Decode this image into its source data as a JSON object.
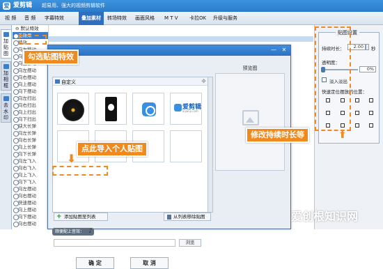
{
  "app": {
    "logo_glyph": "爱",
    "name": "爱剪辑",
    "slogan": "超易用、强大的视频剪辑软件"
  },
  "menu": {
    "items": [
      {
        "label": "视 频",
        "active": false
      },
      {
        "label": "音 频",
        "active": false
      },
      {
        "label": "字幕特效",
        "active": false
      },
      {
        "label": "叠加素材",
        "active": true
      },
      {
        "label": "转场特效",
        "active": false
      },
      {
        "label": "画面风格",
        "active": false
      },
      {
        "label": "M T V",
        "active": false
      },
      {
        "label": "卡拉OK",
        "active": false
      },
      {
        "label": "升级与服务",
        "active": false
      }
    ]
  },
  "side_tabs": [
    {
      "label": "加贴图",
      "active": true
    },
    {
      "label": "加相框",
      "active": false
    },
    {
      "label": "去水印",
      "active": false
    }
  ],
  "tree": {
    "root": "⊖ 默认特效",
    "items": [
      "无效果",
      "特效",
      "向左移动",
      "向右移动",
      "向上移动",
      "向左摆动",
      "向右摆动",
      "向上摆动",
      "向下摆动",
      "向左扫出",
      "向右扫出",
      "向上扫出",
      "向下扫出",
      "缺大长弹",
      "向左长弹",
      "向右长弹",
      "向上长弹",
      "向下长弹",
      "向左飞入",
      "向右飞入",
      "向上飞入",
      "向下飞入",
      "向左摆动",
      "向右摆动",
      "快速摆动",
      "向上摆动",
      "向下摆动",
      "向右摆动"
    ],
    "selected_index": 0
  },
  "properties": {
    "title": "贴图设置",
    "duration_label": "持续时长：",
    "duration_value": "2.00",
    "duration_unit": "秒",
    "opacity_label": "透明度：",
    "opacity_value": "0%",
    "opacity_level": 0,
    "fade_label": "淡入淡出",
    "fade_checked": false,
    "position_label": "快速定位摆放的位置："
  },
  "dialog": {
    "library_title": "自定义",
    "brand_thumb_text": "爱剪辑",
    "brand_thumb_url": "aijianji.com",
    "add_button": "添加贴图至列表",
    "remove_button": "从列表移除贴图",
    "preview_title": "预览图",
    "music_label": "顺便配上音效：",
    "browse_button": "浏览",
    "ok_button": "确 定",
    "cancel_button": "取 消",
    "minimize_glyph": "—",
    "close_glyph": "✕"
  },
  "callouts": {
    "select_effect": "勾选贴图特效",
    "import_sticker": "点此导入个人贴图",
    "change_duration": "修改持续时长等"
  },
  "watermark": "爱创根知识网",
  "colors": {
    "accent_orange": "#f08a1e",
    "title_blue": "#2b7ccb",
    "selected_blue": "#3d7cc9"
  }
}
